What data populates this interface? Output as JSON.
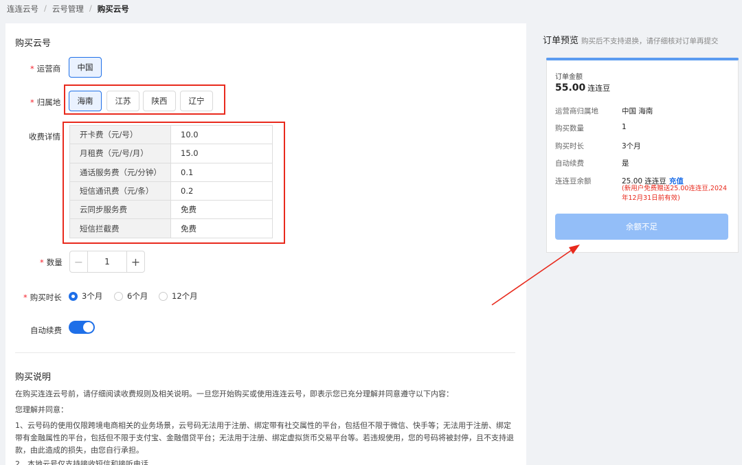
{
  "breadcrumb": [
    "连连云号",
    "云号管理",
    "购买云号"
  ],
  "form": {
    "title": "购买云号",
    "carrier_label": "运营商",
    "carrier_option": "中国",
    "region_label": "归属地",
    "regions": [
      "海南",
      "江苏",
      "陕西",
      "辽宁"
    ],
    "fee_label": "收费详情",
    "fees": [
      {
        "name": "开卡费（元/号）",
        "value": "10.0"
      },
      {
        "name": "月租费（元/号/月）",
        "value": "15.0"
      },
      {
        "name": "通话服务费（元/分钟）",
        "value": "0.1"
      },
      {
        "name": "短信通讯费（元/条）",
        "value": "0.2"
      },
      {
        "name": "云同步服务费",
        "value": "免费"
      },
      {
        "name": "短信拦截费",
        "value": "免费"
      }
    ],
    "quantity_label": "数量",
    "quantity": "1",
    "duration_label": "购买时长",
    "durations": [
      "3个月",
      "6个月",
      "12个月"
    ],
    "auto_renew_label": "自动续费",
    "auto_renew_on": true
  },
  "description": {
    "title": "购买说明",
    "p1": "在购买连连云号前，请仔细阅读收费规则及相关说明。一旦您开始购买或使用连连云号，即表示您已充分理解并同意遵守以下内容：",
    "p2": "您理解并同意：",
    "p3": "1、云号码的使用仅限跨境电商相关的业务场景，云号码无法用于注册、绑定带有社交属性的平台，包括但不限于微信、快手等；无法用于注册、绑定带有金融属性的平台，包括但不限于支付宝、金融借贷平台；无法用于注册、绑定虚拟货币交易平台等。若违规使用，您的号码将被封停，且不支持退款，由此造成的损失，由您自行承担。",
    "p4": "2、本地云号仅支持接收短信和接听电话"
  },
  "order": {
    "title": "订单预览",
    "note": "购买后不支持退换，请仔细核对订单再提交",
    "amount_label": "订单金额",
    "amount": "55.00",
    "amount_unit": "连连豆",
    "rows": [
      {
        "k": "运营商归属地",
        "v": "中国 海南"
      },
      {
        "k": "购买数量",
        "v": "1"
      },
      {
        "k": "购买时长",
        "v": "3个月"
      },
      {
        "k": "自动续费",
        "v": "是"
      }
    ],
    "balance_label": "连连豆余额",
    "balance": "25.00 连连豆",
    "recharge": "充值",
    "promo": "(新用户免费赠送25.00连连豆,2024年12月31日前有效)",
    "submit": "余额不足"
  },
  "colors": {
    "primary": "#1e6fe8",
    "annotation_red": "#e8291c",
    "disabled_button": "#93bef8"
  }
}
